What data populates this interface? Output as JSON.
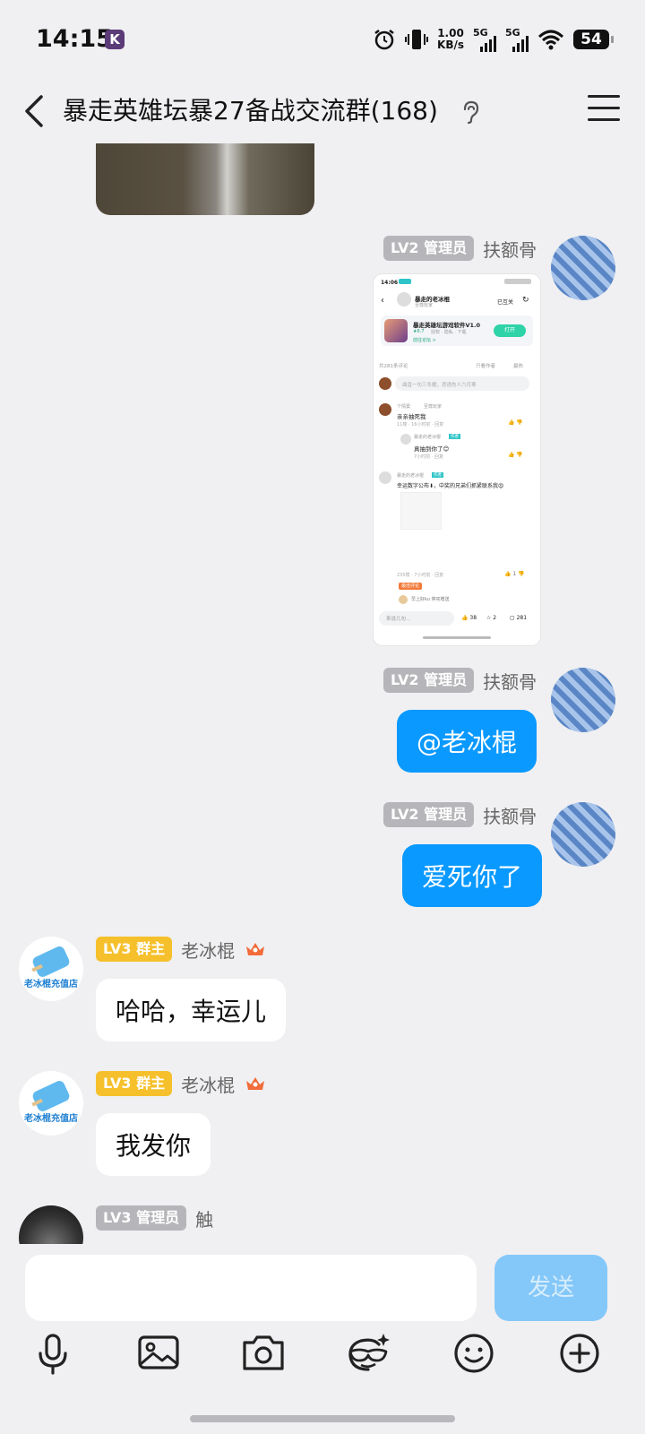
{
  "status_bar": {
    "time": "14:15",
    "notification_badge": "K",
    "speed": "1.00",
    "speed_unit": "KB/s",
    "net1": "5G",
    "net2": "5G",
    "battery": "54"
  },
  "header": {
    "title": "暴走英雄坛暴27备战交流群(168)"
  },
  "messages": [
    {
      "sender": "扶额骨",
      "badge": "LV2 管理员",
      "type": "image"
    },
    {
      "sender": "扶额骨",
      "badge": "LV2 管理员",
      "text": "@老冰棍"
    },
    {
      "sender": "扶额骨",
      "badge": "LV2 管理员",
      "text": "爱死你了"
    },
    {
      "sender": "老冰棍",
      "badge": "LV3 群主",
      "text": "哈哈，幸运儿"
    },
    {
      "sender": "老冰棍",
      "badge": "LV3 群主",
      "text": "我发你"
    },
    {
      "sender": "触",
      "badge": "LV3 管理员"
    }
  ],
  "owner_avatar_caption": "老冰棍充值店",
  "screenshot": {
    "time": "14:06",
    "author": "暴走的老冰棍",
    "author_sub": "至尊玩家",
    "follow": "已互关",
    "app_name": "暴走英雄坛游戏软件V1.0",
    "app_rating": "★6.7",
    "app_sub": "授权 · 隐私 · 下载",
    "app_sub2": "前往论坛 >",
    "open_btn": "打开",
    "comment_count": "共281条评论",
    "filter1": "只看作者",
    "filter2": "最热",
    "input_placeholder": "曲直一句三冬暖，恶语伤人六月寒",
    "c1_name": "个情窦",
    "c1_tag": "至尊玩家",
    "c1_text": "亲亲抽死我",
    "c1_meta": "11楼 · 16小时前 · 回复",
    "r1_name": "暴走的老冰棍",
    "r1_tag": "作者",
    "r1_text": "真抽到你了😊",
    "r1_meta": "7小时前 · 回复",
    "c2_name": "暴走的老冰棍",
    "c2_tag": "作者",
    "c2_text": "幸运数字公布⬇，中奖的兄弟们抓紧联系我😍",
    "c2_meta": "235楼 · 7小时前 · 回复",
    "c2_like": "1",
    "hot_tag": "最佳评论",
    "c3_text": "早上好ku 停买赠送",
    "bottom_input": "来说几句...",
    "likes": "38",
    "stars": "2",
    "comments": "281"
  },
  "input": {
    "placeholder": "",
    "send_label": "发送"
  }
}
